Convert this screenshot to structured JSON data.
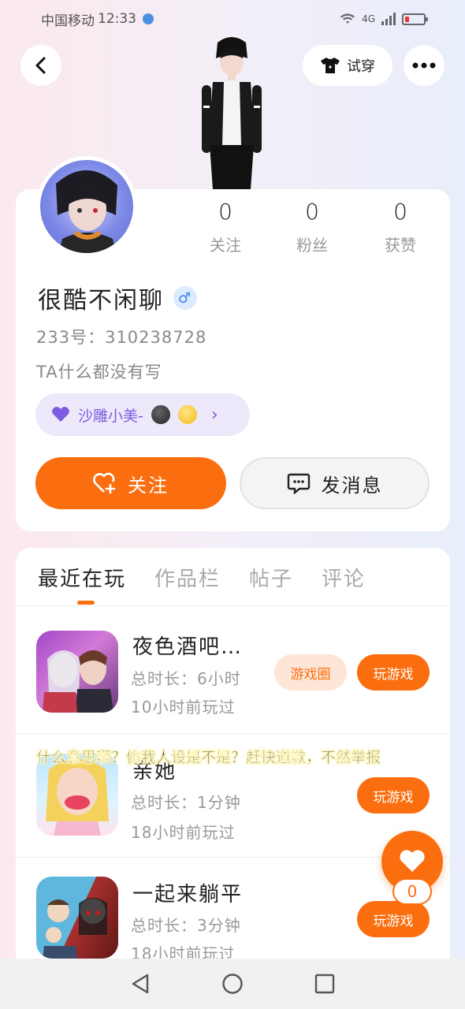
{
  "status_bar": {
    "carrier": "中国移动",
    "time": "12:33",
    "network": "4G",
    "battery": "10"
  },
  "header": {
    "tryon_label": "试穿"
  },
  "profile": {
    "name": "很酷不闲聊",
    "gender_symbol": "♂",
    "id_line": "233号：310238728",
    "bio": "TA什么都没有写",
    "stats": [
      {
        "value": "0",
        "label": "关注"
      },
      {
        "value": "0",
        "label": "粉丝"
      },
      {
        "value": "0",
        "label": "获赞"
      }
    ],
    "tag": {
      "text": "沙雕小美-",
      "arrow": "›"
    },
    "follow_label": "关注",
    "message_label": "发消息"
  },
  "tabs": [
    {
      "label": "最近在玩"
    },
    {
      "label": "作品栏"
    },
    {
      "label": "帖子"
    },
    {
      "label": "评论"
    }
  ],
  "games": [
    {
      "title": "夜色酒吧…",
      "duration": "总时长：6小时",
      "last_played": "10小时前玩过",
      "circle_label": "游戏圈",
      "play_label": "玩游戏"
    },
    {
      "title": "亲她",
      "duration": "总时长：1分钟",
      "last_played": "18小时前玩过",
      "play_label": "玩游戏"
    },
    {
      "title": "一起来躺平",
      "duration": "总时长：3分钟",
      "last_played": "18小时前玩过",
      "play_label": "玩游戏"
    }
  ],
  "overlay_subtitle": "什么意思啊？偷我人设是不是？赶快道歉，不然举报",
  "like_count": "0",
  "colors": {
    "accent": "#fb6e0f",
    "tag_purple": "#7c5ce0"
  }
}
